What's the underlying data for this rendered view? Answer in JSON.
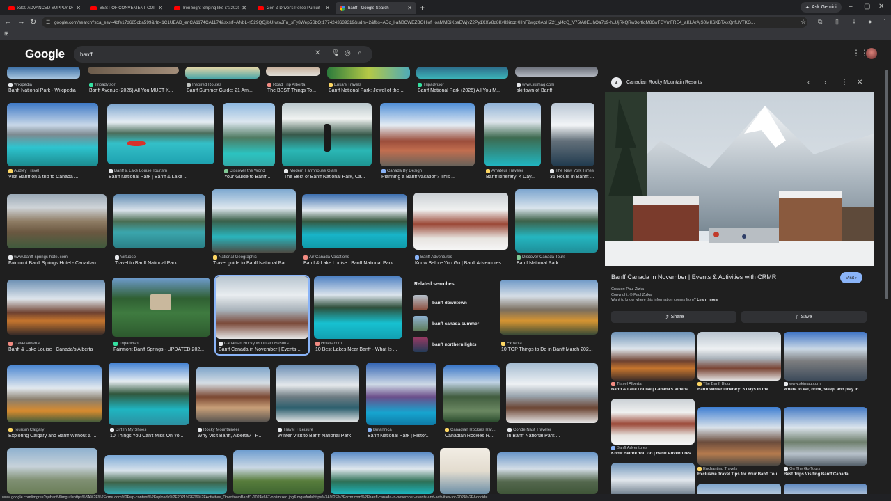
{
  "browser": {
    "tabs": [
      {
        "label": "x300 ADVANCED SUPPLY DRO...",
        "type": "yt"
      },
      {
        "label": "BEST OF CONVENIENT COP 20...",
        "type": "yt"
      },
      {
        "label": "Iron Sight Sniping like it's 2020",
        "type": "yt"
      },
      {
        "label": "Gen Z Driver's Police Pursuit E...",
        "type": "yt"
      },
      {
        "label": "banff - Google Search",
        "type": "google",
        "active": true
      }
    ],
    "ask_gemini": "Ask Gemini",
    "url": "google.com/search?sca_esv=4bfe17d685cba599&rlz=1C1UEAD_enCA1174CA1174&sxsrf=ANbL-n529QQjibUNavJFn_sFy8Wep5SbQ:1774243639319&udm=2&fbs=ADc_l-aN0CWEZBOHjofHoaMMDiKpaEWjvZ2Py1XXV8d8KvlI3izczKHhF2wgz0AoHZ2f_yl4zQ_V75tA8EUhOa7p9-hLUjRkQRw3ortlqM86wFGVmFRE4_aKLArAjS0MK6KBTAxQnfUVTKG..."
  },
  "search": {
    "logo": "Google",
    "query": "banff"
  },
  "results_top_row": [
    {
      "source": "Wikipedia",
      "title": "Banff National Park - Wikipedia",
      "fav": "#e8eaed"
    },
    {
      "source": "Tripadvisor",
      "title": "Banff Avenue (2026) All You MUST K...",
      "fav": "#34e0a1"
    },
    {
      "source": "Inspired Routes",
      "title": "Banff Summer Guide: 21 Am...",
      "fav": "#c4c7c5"
    },
    {
      "source": "Road Trip Alberta",
      "title": "The BEST Things To...",
      "fav": "#f28b82"
    },
    {
      "source": "Erika's Travels",
      "title": "Banff National Park: Jewel of the ...",
      "fav": "#fdd663"
    },
    {
      "source": "Tripadvisor",
      "title": "Banff National Park (2026) All You M...",
      "fav": "#34e0a1"
    },
    {
      "source": "www.skimag.com",
      "title": "ski town of Banff",
      "fav": "#e8eaed"
    }
  ],
  "results_row2": [
    {
      "source": "Audley Travel",
      "title": "Visit Banff on a trip to Canada ...",
      "fav": "#fdd663"
    },
    {
      "source": "Banff & Lake Louise Tourism",
      "title": "Banff National Park | Banff & Lake ...",
      "fav": "#e8eaed"
    },
    {
      "source": "Discover the World",
      "title": "Your Guide to Banff ...",
      "fav": "#81c995"
    },
    {
      "source": "Modern Farmhouse Glam",
      "title": "The Best of Banff National Park, Ca...",
      "fav": "#e8eaed"
    },
    {
      "source": "Canada By Design",
      "title": "Planning a Banff vacation? This ...",
      "fav": "#8ab4f8"
    },
    {
      "source": "Amateur Traveler",
      "title": "Banff Itinerary: 4 Day...",
      "fav": "#fdd663"
    },
    {
      "source": "The New York Times",
      "title": "36 Hours in Banff: ...",
      "fav": "#e8eaed"
    }
  ],
  "results_row3": [
    {
      "source": "www.banff-springs-hotel.com",
      "title": "Fairmont Banff Springs Hotel - Canadian ...",
      "fav": "#e8eaed"
    },
    {
      "source": "Virtuoso",
      "title": "Travel to Banff National Park ...",
      "fav": "#e8eaed"
    },
    {
      "source": "National Geographic",
      "title": "Travel guide to Banff National Par...",
      "fav": "#fdd663"
    },
    {
      "source": "Air Canada Vacations",
      "title": "Banff & Lake Louise | Banff National Park",
      "fav": "#f28b82"
    },
    {
      "source": "Banff Adventures",
      "title": "Know Before You Go | Banff Adventures",
      "fav": "#8ab4f8"
    },
    {
      "source": "Discover Canada Tours",
      "title": "Banff National Park ...",
      "fav": "#81c995"
    }
  ],
  "results_row4": [
    {
      "source": "Travel Alberta",
      "title": "Banff & Lake Louise | Canada's Alberta",
      "fav": "#f28b82"
    },
    {
      "source": "Tripadvisor",
      "title": "Fairmont Banff Springs - UPDATED 202...",
      "fav": "#34e0a1"
    },
    {
      "source": "Canadian Rocky Mountain Resorts",
      "title": "Banff Canada in November | Events ...",
      "fav": "#e8eaed"
    },
    {
      "source": "Hotels.com",
      "title": "10 Best Lakes Near Banff - What Is ...",
      "fav": "#f28b82"
    },
    {
      "source": "Expedia",
      "title": "10 TOP Things to Do in Banff March 202...",
      "fav": "#fdd663"
    }
  ],
  "related": {
    "header": "Related searches",
    "items": [
      "banff downtown",
      "banff canada summer",
      "banff northern lights"
    ]
  },
  "results_row5": [
    {
      "source": "Tourism Calgary",
      "title": "Exploring Calgary and Banff Without a ...",
      "fav": "#fdd663"
    },
    {
      "source": "Dirt In My Shoes",
      "title": "10 Things You Can't Miss On Yo...",
      "fav": "#e8eaed"
    },
    {
      "source": "Rocky Mountaineer",
      "title": "Why Visit Banff, Alberta? | R...",
      "fav": "#e8eaed"
    },
    {
      "source": "Travel + Leisure",
      "title": "Winter Visit to Banff National Park",
      "fav": "#e8eaed"
    },
    {
      "source": "Britannica",
      "title": "Banff National Park | Histor...",
      "fav": "#8ab4f8"
    },
    {
      "source": "Canadian Rockies Raf...",
      "title": "Canadian Rockies R...",
      "fav": "#fdd663"
    },
    {
      "source": "Conde Nast Traveler",
      "title": "in Banff National Park ...",
      "fav": "#e8eaed"
    }
  ],
  "preview": {
    "site": "Canadian Rocky Mountain Resorts",
    "title": "Banff Canada in November | Events & Activities with CRMR",
    "visit": "Visit",
    "creator": "Creator: Paul Zizka",
    "copyright": "Copyright: © Paul Zizka",
    "want_to_know": "Want to know where this information comes from?",
    "learn_more": "Learn more",
    "share": "Share",
    "save": "Save",
    "related": [
      {
        "source": "Travel Alberta",
        "title": "Banff & Lake Louise | Canada's Alberta",
        "fav": "#f28b82"
      },
      {
        "source": "The Banff Blog",
        "title": "Banff Winter Itinerary: 5 Days in the...",
        "fav": "#fdd663"
      },
      {
        "source": "www.skimag.com",
        "title": "Where to eat, drink, sleep, and play in...",
        "fav": "#e8eaed"
      },
      {
        "source": "Banff Adventures",
        "title": "Know Before You Go | Banff Adventures",
        "fav": "#8ab4f8"
      },
      {
        "source": "Enchanting Travels",
        "title": "Exclusive Travel Tips for Your Banff Tou...",
        "fav": "#fdd663"
      },
      {
        "source": "On The Go Tours",
        "title": "Best Trips Visiting Banff Canada",
        "fav": "#e8eaed"
      }
    ]
  },
  "status_url": "www.google.com/imgres?q=banff&imgurl=https%3A%2F%2Fcrmr.com%2Fwp-content%2Fuploads%2F2021%2F06%2FActivities_DowntownBanff1-1024x667-optimized.jpg&imgrefurl=https%3A%2F%2Fcrmr.com%2Fbanff-canada-in-november-events-and-activities-for-2024%2F&docid=..."
}
